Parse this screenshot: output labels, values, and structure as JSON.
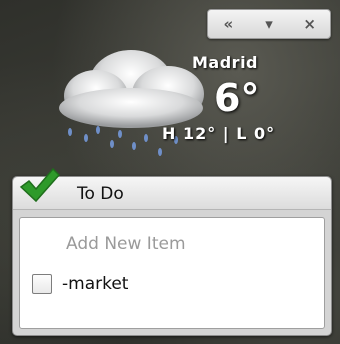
{
  "weather": {
    "city": "Madrid",
    "temperature": "6°",
    "hi_lo": "H 12° | L 0°",
    "condition_icon": "rain-cloud-icon"
  },
  "window_controls": {
    "collapse_glyph": "«",
    "dropdown_glyph": "▾",
    "close_glyph": "×"
  },
  "todo": {
    "title": "To Do",
    "add_placeholder": "Add New Item",
    "items": [
      {
        "text": "-market",
        "checked": false
      }
    ],
    "accent_color": "#2e9a2a"
  }
}
